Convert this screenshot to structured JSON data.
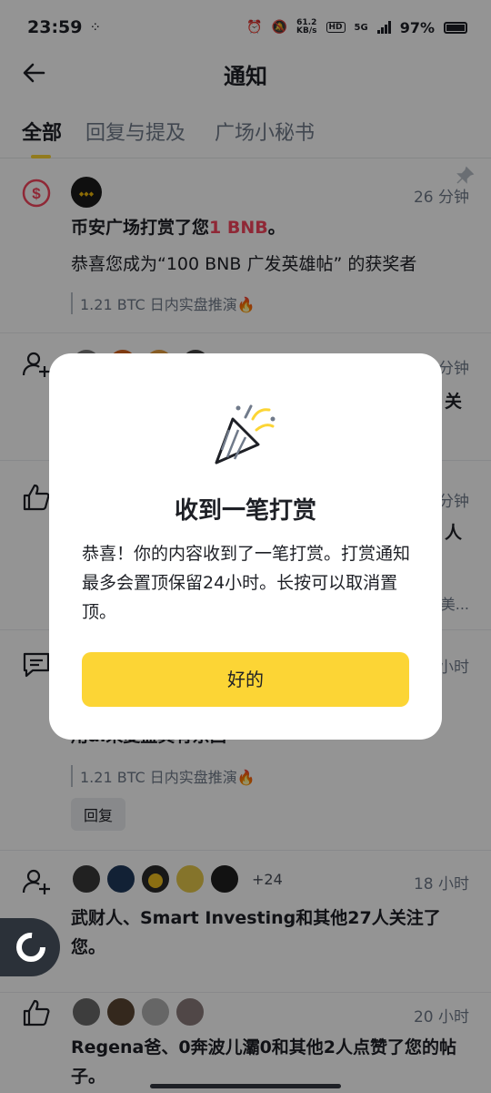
{
  "status_bar": {
    "time": "23:59",
    "network_speed_value": "61.2",
    "network_speed_unit": "KB/s",
    "hd": "HD",
    "net_type": "5G",
    "battery_pct": "97%"
  },
  "header": {
    "title": "通知"
  },
  "tabs": [
    {
      "label": "全部",
      "active": true
    },
    {
      "label": "回复与提及",
      "active": false
    },
    {
      "label": "广场小秘书",
      "active": false
    }
  ],
  "notifications": [
    {
      "icon": "dollar-coin-icon",
      "time": "26 分钟",
      "title_prefix": "币安广场打赏了您",
      "title_amount": "1 BNB",
      "title_suffix": "。",
      "body": "恭喜您成为“100 BNB 广发英雄帖” 的获奖者",
      "reference": "1.21 BTC 日内实盘推演🔥",
      "pinned": true
    },
    {
      "icon": "follow-icon",
      "time": "分钟",
      "partial": "关"
    },
    {
      "icon": "thumbs-up-icon",
      "time": "分钟",
      "partial": "人",
      "partial2": "美..."
    },
    {
      "icon": "comment-icon",
      "time": "小时",
      "partial": "用ai来复盘真有东西",
      "reference": "1.21 BTC 日内实盘推演🔥",
      "reply_label": "回复"
    },
    {
      "icon": "follow-icon",
      "time": "18 小时",
      "count": "+24",
      "text": "武财人、Smart Investing和其他27人关注了您。"
    },
    {
      "icon": "thumbs-up-icon",
      "time": "20 小时",
      "text": "Regena爸、0奔波儿灞0和其他2人点赞了您的帖子。"
    }
  ],
  "modal": {
    "title": "收到一笔打赏",
    "body": "恭喜！你的内容收到了一笔打赏。打赏通知最多会置顶保留24小时。长按可以取消置顶。",
    "button": "好的"
  },
  "colors": {
    "accent": "#fcd535",
    "amount_red": "#f6465d",
    "dollar_icon": "#f6465d"
  }
}
